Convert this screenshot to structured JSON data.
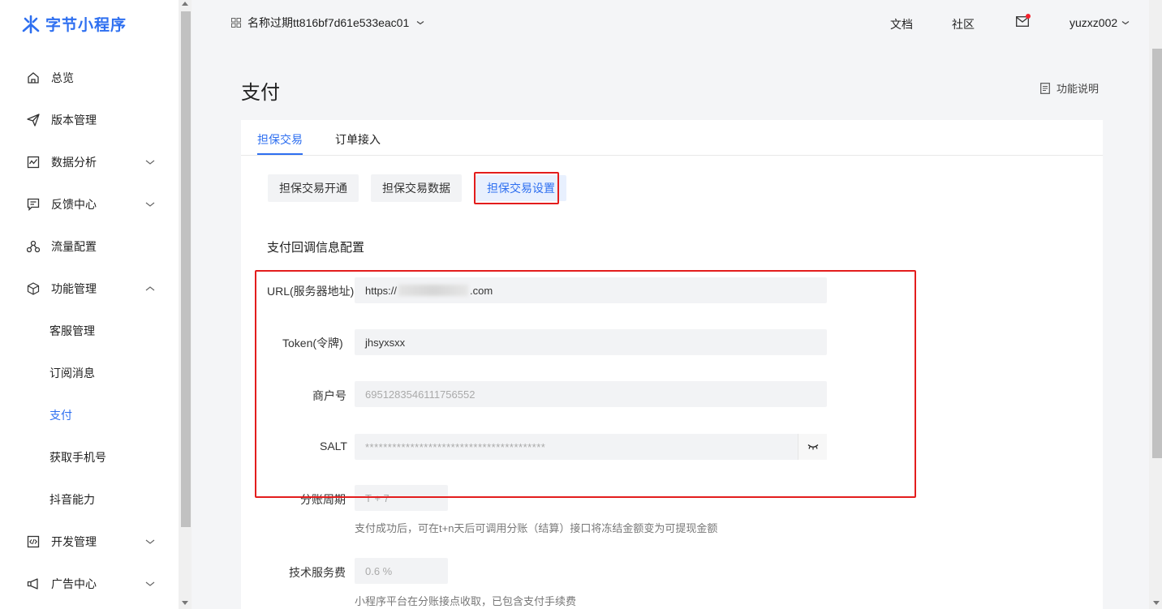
{
  "brand": {
    "name": "字节小程序",
    "color": "#2e6ff0"
  },
  "header": {
    "app_name": "名称过期tt816bf7d61e533eac01",
    "docs": "文档",
    "community": "社区",
    "username": "yuzxz002"
  },
  "sidebar": {
    "items": [
      {
        "label": "总览",
        "icon": "home-icon"
      },
      {
        "label": "版本管理",
        "icon": "send-icon"
      },
      {
        "label": "数据分析",
        "icon": "chart-icon",
        "expandable": true
      },
      {
        "label": "反馈中心",
        "icon": "message-icon",
        "expandable": true
      },
      {
        "label": "流量配置",
        "icon": "share-icon"
      },
      {
        "label": "功能管理",
        "icon": "cube-icon",
        "expanded": true
      },
      {
        "label": "客服管理",
        "sub": true
      },
      {
        "label": "订阅消息",
        "sub": true
      },
      {
        "label": "支付",
        "sub": true,
        "active": true
      },
      {
        "label": "获取手机号",
        "sub": true
      },
      {
        "label": "抖音能力",
        "sub": true
      },
      {
        "label": "开发管理",
        "icon": "code-icon",
        "expandable": true
      },
      {
        "label": "广告中心",
        "icon": "megaphone-icon",
        "expandable": true
      }
    ]
  },
  "page": {
    "title": "支付",
    "func_desc": "功能说明",
    "tabs": [
      {
        "label": "担保交易",
        "active": true
      },
      {
        "label": "订单接入"
      }
    ],
    "subtabs": [
      {
        "label": "担保交易开通"
      },
      {
        "label": "担保交易数据"
      },
      {
        "label": "担保交易设置",
        "active": true
      }
    ],
    "section_title": "支付回调信息配置",
    "form": {
      "url_label": "URL(服务器地址)",
      "url_prefix": "https://",
      "url_suffix": ".com",
      "token_label": "Token(令牌)",
      "token_value": "jhsyxsxx",
      "merchant_label": "商户号",
      "merchant_value": "69512835461117565​52",
      "salt_label": "SALT",
      "salt_value": "****************************************",
      "period_label": "分账周期",
      "period_value": "T + 7",
      "period_help": "支付成功后，可在t+n天后可调用分账（结算）接口将冻结金额变为可提现金额",
      "fee_label": "技术服务费",
      "fee_value": "0.6 %",
      "fee_help": "小程序平台在分账接点收取，已包含支付手续费"
    }
  },
  "colors": {
    "accent": "#2e6ff0",
    "highlight": "#e31d1d",
    "notify": "#f5222d"
  }
}
